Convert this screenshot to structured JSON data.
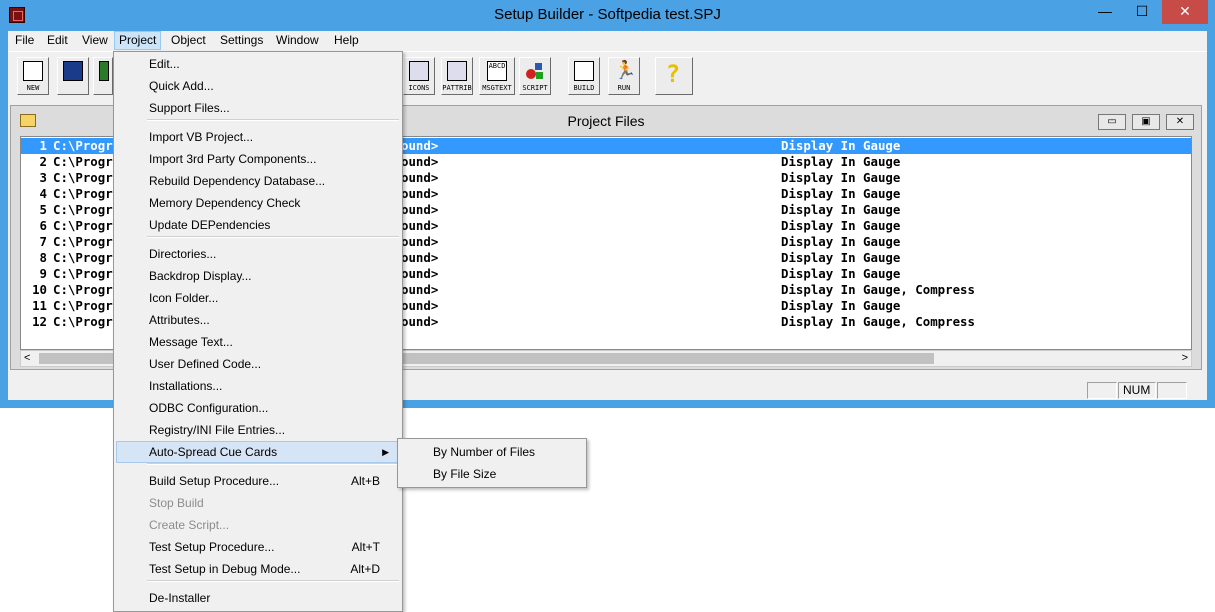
{
  "window": {
    "title": "Setup Builder - Softpedia test.SPJ",
    "min_glyph": "—",
    "max_glyph": "☐",
    "close_glyph": "✕"
  },
  "menubar": [
    "File",
    "Edit",
    "View",
    "Project",
    "Object",
    "Settings",
    "Window",
    "Help"
  ],
  "toolbar": [
    {
      "label": "NEW",
      "icon": "new-document-icon"
    },
    {
      "label": "",
      "icon": "save-disk-icon"
    },
    {
      "label": "",
      "icon": "open-icon"
    },
    {
      "label": "ICONS",
      "icon": "icons-icon"
    },
    {
      "label": "PATTRIB",
      "icon": "pattrib-icon"
    },
    {
      "label": "ABCD",
      "icon": "msgtext-icon"
    },
    {
      "label": "MSGTEXT",
      "icon": "msgtext-label"
    },
    {
      "label": "SCRIPT",
      "icon": "script-icon"
    },
    {
      "label": "BUILD",
      "icon": "build-icon"
    },
    {
      "label": "RUN",
      "icon": "run-icon"
    }
  ],
  "child": {
    "title": "Project Files",
    "rows": [
      {
        "num": "1",
        "path": "C:\\Progr",
        "dest": "ound>",
        "opt": "Display In Gauge"
      },
      {
        "num": "2",
        "path": "C:\\Progr",
        "dest": "ound>",
        "opt": "Display In Gauge"
      },
      {
        "num": "3",
        "path": "C:\\Progr",
        "dest": "ound>",
        "opt": "Display In Gauge"
      },
      {
        "num": "4",
        "path": "C:\\Progr",
        "dest": "ound>",
        "opt": "Display In Gauge"
      },
      {
        "num": "5",
        "path": "C:\\Progr",
        "dest": "ound>",
        "opt": "Display In Gauge"
      },
      {
        "num": "6",
        "path": "C:\\Progr",
        "dest": "ound>",
        "opt": "Display In Gauge"
      },
      {
        "num": "7",
        "path": "C:\\Progr",
        "dest": "ound>",
        "opt": "Display In Gauge"
      },
      {
        "num": "8",
        "path": "C:\\Progr",
        "dest": "ound>",
        "opt": "Display In Gauge"
      },
      {
        "num": "9",
        "path": "C:\\Progr",
        "dest": "ound>",
        "opt": "Display In Gauge"
      },
      {
        "num": "10",
        "path": "C:\\Progr",
        "dest": "ound>",
        "opt": "Display In Gauge, Compress"
      },
      {
        "num": "11",
        "path": "C:\\Progr",
        "dest": "ound>",
        "opt": "Display In Gauge"
      },
      {
        "num": "12",
        "path": "C:\\Progr",
        "dest": "ound>",
        "opt": "Display In Gauge, Compress"
      }
    ]
  },
  "status": {
    "num": "NUM"
  },
  "project_menu": [
    {
      "label": "Edit...",
      "shortcut": "",
      "disabled": false
    },
    {
      "label": "Quick Add...",
      "shortcut": "",
      "disabled": false
    },
    {
      "label": "Support Files...",
      "shortcut": "",
      "disabled": false
    },
    {
      "sep": true
    },
    {
      "label": "Import VB Project...",
      "shortcut": "",
      "disabled": false
    },
    {
      "label": "Import 3rd Party Components...",
      "shortcut": "",
      "disabled": false
    },
    {
      "label": "Rebuild Dependency Database...",
      "shortcut": "",
      "disabled": false
    },
    {
      "label": "Memory Dependency Check",
      "shortcut": "",
      "disabled": false
    },
    {
      "label": "Update DEPendencies",
      "shortcut": "",
      "disabled": false
    },
    {
      "sep": true
    },
    {
      "label": "Directories...",
      "shortcut": "",
      "disabled": false
    },
    {
      "label": "Backdrop Display...",
      "shortcut": "",
      "disabled": false
    },
    {
      "label": "Icon Folder...",
      "shortcut": "",
      "disabled": false
    },
    {
      "label": "Attributes...",
      "shortcut": "",
      "disabled": false
    },
    {
      "label": "Message Text...",
      "shortcut": "",
      "disabled": false
    },
    {
      "label": "User Defined Code...",
      "shortcut": "",
      "disabled": false
    },
    {
      "label": "Installations...",
      "shortcut": "",
      "disabled": false
    },
    {
      "label": "ODBC Configuration...",
      "shortcut": "",
      "disabled": false
    },
    {
      "label": "Registry/INI File Entries...",
      "shortcut": "",
      "disabled": false
    },
    {
      "label": "Auto-Spread Cue Cards",
      "shortcut": "",
      "disabled": false,
      "submenu": true,
      "highlighted": true
    },
    {
      "sep": true
    },
    {
      "label": "Build Setup Procedure...",
      "shortcut": "Alt+B",
      "disabled": false
    },
    {
      "label": "Stop Build",
      "shortcut": "",
      "disabled": true
    },
    {
      "label": "Create Script...",
      "shortcut": "",
      "disabled": true
    },
    {
      "label": "Test Setup Procedure...",
      "shortcut": "Alt+T",
      "disabled": false
    },
    {
      "label": "Test Setup in Debug Mode...",
      "shortcut": "Alt+D",
      "disabled": false
    },
    {
      "sep": true
    },
    {
      "label": "De-Installer",
      "shortcut": "",
      "disabled": false
    }
  ],
  "submenu": [
    "By Number of Files",
    "By File Size"
  ],
  "colors": {
    "selection": "#3399ff",
    "titlebar": "#4aa1e4",
    "menu_highlight": "#d5e5f6"
  }
}
